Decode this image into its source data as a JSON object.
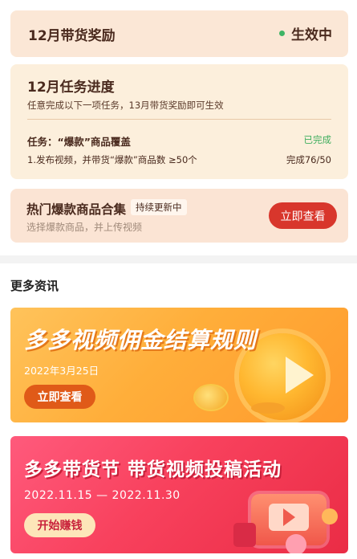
{
  "reward": {
    "title": "12月带货奖励",
    "status": "生效中",
    "status_color": "#3fb465"
  },
  "progress": {
    "title": "12月任务进度",
    "description": "任意完成以下一项任务，13月带货奖励即可生效",
    "task_label": "任务：“爆款”商品覆盖",
    "task_state": "已完成",
    "task_requirement": "1.发布视频，并带货“爆款”商品数 ≥50个",
    "task_count": "完成76/50"
  },
  "hot": {
    "title": "热门爆款商品合集",
    "badge": "持续更新中",
    "subtitle": "选择爆款商品，并上传视频",
    "button": "立即查看"
  },
  "more": {
    "title": "更多资讯"
  },
  "banners": [
    {
      "title": "多多视频佣金结算规则",
      "date": "2022年3月25日",
      "button": "立即查看",
      "accent": "#ffae3a"
    },
    {
      "title": "多多带货节 带货视频投稿活动",
      "date": "2022.11.15 — 2022.11.30",
      "button": "开始赚钱",
      "accent": "#f8415d"
    }
  ],
  "colors": {
    "primary_button": "#d8362c",
    "card_bg": "#fbe7d6"
  }
}
